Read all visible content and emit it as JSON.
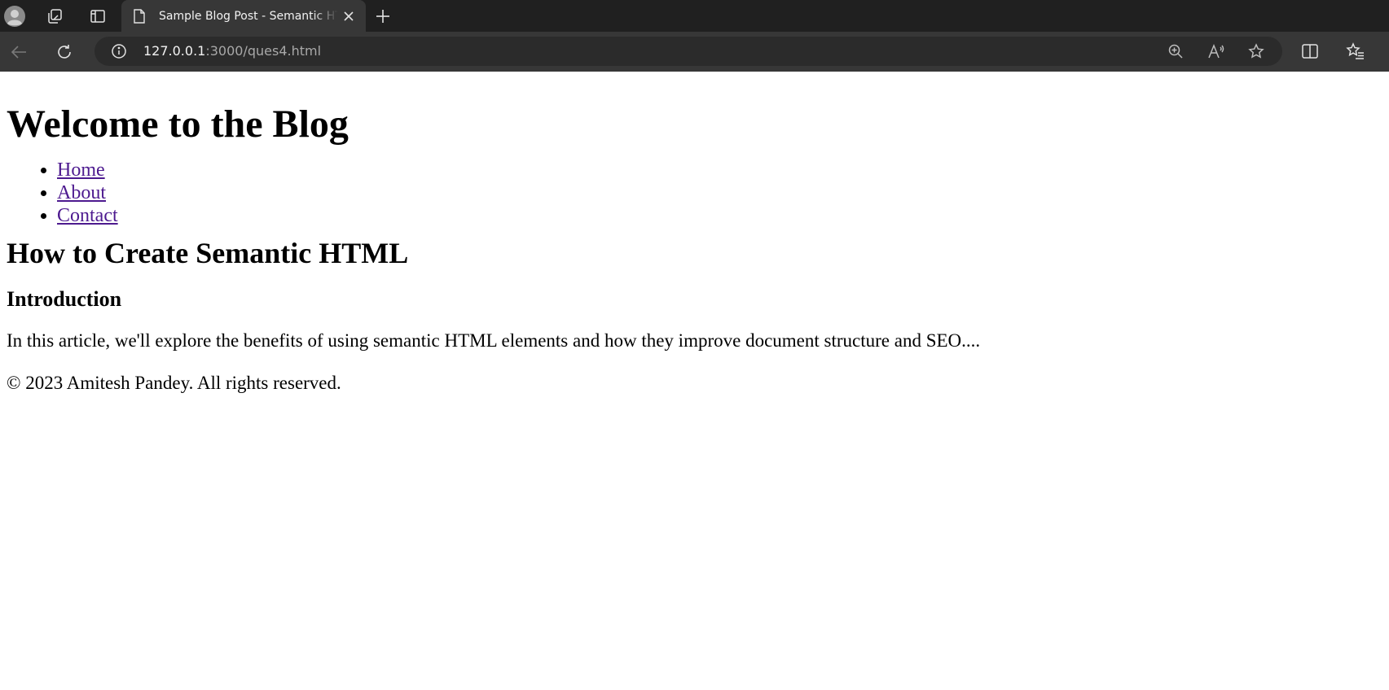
{
  "browser": {
    "tab": {
      "title": "Sample Blog Post - Semantic HTML"
    },
    "address": {
      "host": "127.0.0.1",
      "rest": ":3000/ques4.html"
    },
    "icons": {
      "profile": "profile-avatar-icon",
      "workspaces": "workspaces-icon",
      "vertical_tabs": "vertical-tabs-icon",
      "tab_page": "document-icon",
      "tab_close": "close-icon",
      "new_tab": "plus-icon",
      "back": "back-arrow-icon",
      "reload": "reload-icon",
      "site_info": "info-icon",
      "zoom": "zoom-icon",
      "read_aloud": "read-aloud-icon",
      "favorite": "star-icon",
      "split_screen": "split-screen-icon",
      "favorites": "favorites-icon"
    },
    "colors": {
      "tabbar_bg": "#202020",
      "toolbar_bg": "#373737",
      "omnibox_bg": "#2b2b2b"
    }
  },
  "page": {
    "site_title": "Welcome to the Blog",
    "nav": [
      {
        "label": "Home"
      },
      {
        "label": "About"
      },
      {
        "label": "Contact"
      }
    ],
    "post_title": "How to Create Semantic HTML",
    "section_heading": "Introduction",
    "section_text": "In this article, we'll explore the benefits of using semantic HTML elements and how they improve document structure and SEO....",
    "footer": "© 2023 Amitesh Pandey. All rights reserved.",
    "colors": {
      "visited_link": "#4d1a8f",
      "text": "#000000"
    }
  }
}
